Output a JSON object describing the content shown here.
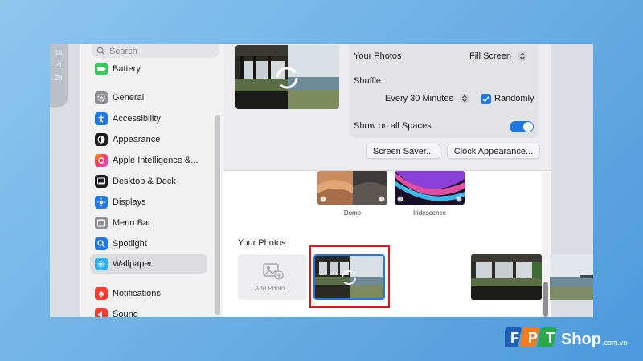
{
  "calendar_days": [
    "14",
    "21",
    "28"
  ],
  "sidebar": {
    "search_placeholder": "Search",
    "items": [
      {
        "label": "Battery",
        "icon": "battery-icon",
        "color": "#34c759"
      },
      {
        "label": "General",
        "icon": "gear-icon",
        "color": "#8e8e93"
      },
      {
        "label": "Accessibility",
        "icon": "accessibility-icon",
        "color": "#1f78e6"
      },
      {
        "label": "Appearance",
        "icon": "appearance-icon",
        "color": "#1d1d1f"
      },
      {
        "label": "Apple Intelligence &...",
        "icon": "apple-intelligence-icon",
        "color": "#ff6b6b"
      },
      {
        "label": "Desktop & Dock",
        "icon": "dock-icon",
        "color": "#1d1d1f"
      },
      {
        "label": "Displays",
        "icon": "display-icon",
        "color": "#1f78e6"
      },
      {
        "label": "Menu Bar",
        "icon": "menu-bar-icon",
        "color": "#8e8e93"
      },
      {
        "label": "Spotlight",
        "icon": "spotlight-icon",
        "color": "#1f78e6"
      },
      {
        "label": "Wallpaper",
        "icon": "wallpaper-icon",
        "color": "#30b0f0",
        "active": true
      },
      {
        "label": "Notifications",
        "icon": "notifications-icon",
        "color": "#ff3b30"
      },
      {
        "label": "Sound",
        "icon": "sound-icon",
        "color": "#ff3b30"
      }
    ]
  },
  "options": {
    "your_photos_label": "Your Photos",
    "your_photos_value": "Fill Screen",
    "shuffle_label": "Shuffle",
    "shuffle_value": "Every 30 Minutes",
    "randomly_label": "Randomly",
    "randomly_checked": true,
    "show_all_spaces_label": "Show on all Spaces",
    "show_all_spaces_on": true
  },
  "buttons": {
    "screen_saver": "Screen Saver...",
    "clock_appearance": "Clock Appearance..."
  },
  "wallpapers": [
    {
      "label": "Dome"
    },
    {
      "label": "Iridescence"
    }
  ],
  "your_photos": {
    "title": "Your Photos",
    "add_photo_label": "Add Photo..."
  },
  "brand": {
    "name": "FPT",
    "shop": "Shop",
    "domain": ".com.vn",
    "colors": {
      "blue": "#1f5fb5",
      "orange": "#f47b20",
      "green": "#2aa84a"
    }
  },
  "accent_color": "#1f78e6",
  "highlight_color": "#e0161e"
}
